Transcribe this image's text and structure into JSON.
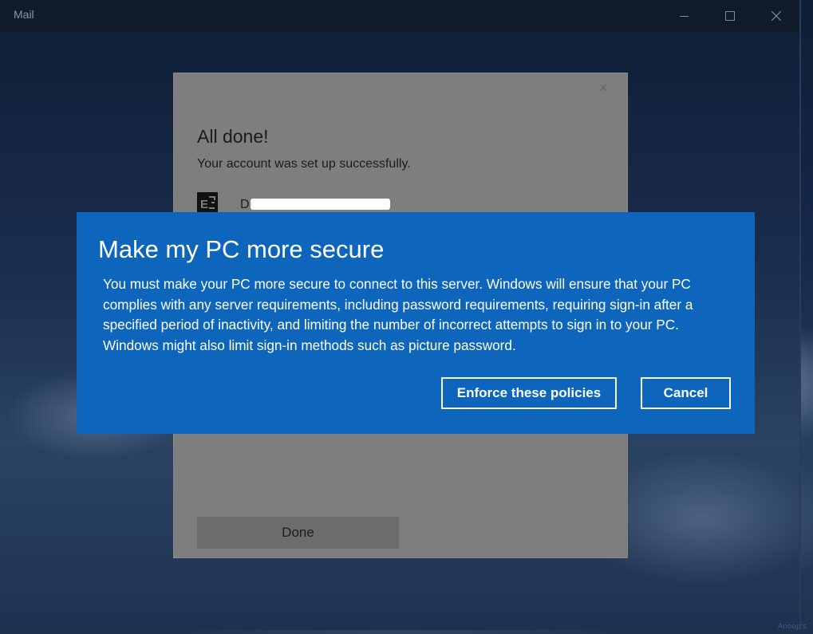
{
  "window": {
    "title": "Mail",
    "minimize_icon": "minimize-icon",
    "maximize_icon": "maximize-icon",
    "close_icon": "close-icon"
  },
  "account_dialog": {
    "close_glyph": "×",
    "title": "All done!",
    "subtitle": "Your account was set up successfully.",
    "account_icon": "exchange-icon",
    "account_name_visible": "D",
    "done_label": "Done"
  },
  "security_dialog": {
    "title": "Make my PC more secure",
    "body": "You must make your PC more secure to connect to this server. Windows will ensure that your PC complies with any server requirements, including password requirements, requiring sign-in after a specified period of inactivity, and limiting the number of incorrect attempts to sign in to your PC. Windows might also limit sign-in methods such as picture password.",
    "enforce_label": "Enforce these policies",
    "cancel_label": "Cancel"
  },
  "watermark": "Anoop's",
  "colors": {
    "dialog_blue": "#0d66bb",
    "titlebar": "#0f1a2b",
    "dimmed_panel": "#7e7e7e"
  }
}
